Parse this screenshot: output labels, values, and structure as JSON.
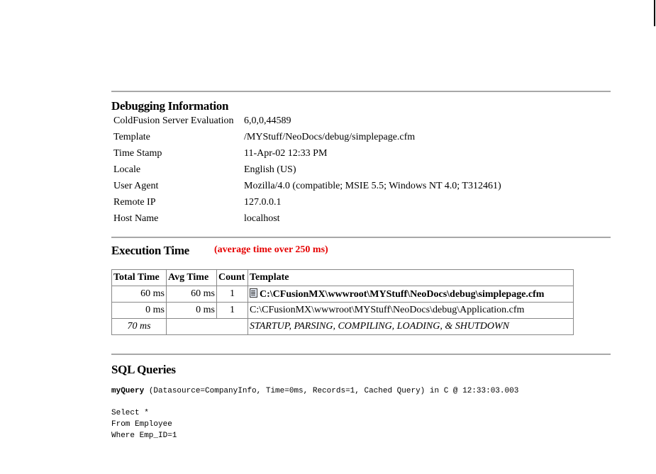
{
  "debug": {
    "title": "Debugging Information",
    "rows": [
      {
        "label": "ColdFusion Server Evaluation",
        "value": "6,0,0,44589"
      },
      {
        "label": "Template",
        "value": "/MYStuff/NeoDocs/debug/simplepage.cfm"
      },
      {
        "label": "Time Stamp",
        "value": "11-Apr-02 12:33 PM"
      },
      {
        "label": "Locale",
        "value": "English (US)"
      },
      {
        "label": "User Agent",
        "value": "Mozilla/4.0 (compatible; MSIE 5.5; Windows NT 4.0; T312461)"
      },
      {
        "label": "Remote IP",
        "value": "127.0.0.1"
      },
      {
        "label": "Host Name",
        "value": "localhost"
      }
    ]
  },
  "execution": {
    "title": "Execution Time",
    "note": "(average time over 250 ms)",
    "note_color": "#e60000",
    "headers": [
      "Total Time",
      "Avg Time",
      "Count",
      "Template"
    ],
    "rows": [
      {
        "total": "60 ms",
        "avg": "60 ms",
        "count": "1",
        "template": "C:\\CFusionMX\\wwwroot\\MYStuff\\NeoDocs\\debug\\simplepage.cfm",
        "icon": "file-icon"
      },
      {
        "total": "0 ms",
        "avg": "0 ms",
        "count": "1",
        "template": "C:\\CFusionMX\\wwwroot\\MYStuff\\NeoDocs\\debug\\Application.cfm"
      }
    ],
    "startup": {
      "total": "70 ms",
      "label": "STARTUP, PARSING, COMPILING, LOADING, & SHUTDOWN"
    }
  },
  "sql": {
    "title": "SQL Queries",
    "query_name": "myQuery",
    "query_details": " (Datasource=CompanyInfo, Time=0ms, Records=1, Cached Query) in C @ 12:33:03.003",
    "lines": [
      "Select *",
      "From Employee",
      "Where Emp_ID=1"
    ]
  }
}
